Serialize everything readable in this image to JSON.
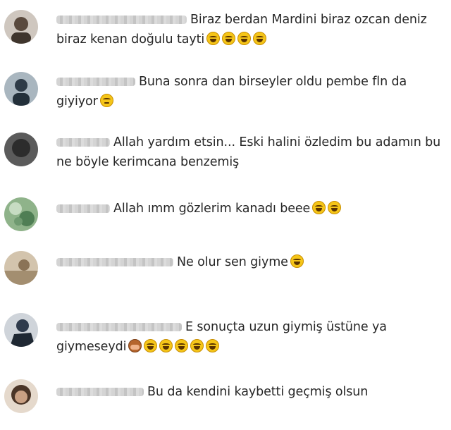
{
  "comments": [
    {
      "avatar_color": "#5a4a3e",
      "text": "Biraz berdan Mardini biraz ozcan deniz biraz kenan doğulu tayti",
      "emojis": [
        "laughing-tears",
        "laughing-tears",
        "laughing-tears",
        "laughing-tears"
      ]
    },
    {
      "avatar_color": "#4a6070",
      "text": "Buna sonra dan birseyler oldu pembe fln da giyiyor",
      "emojis": [
        "thinking-face"
      ]
    },
    {
      "avatar_color": "#3c3c3c",
      "text": "Allah yardım etsin... Eski halini özledim bu adamın bu ne böyle kerimcana benzemiş",
      "emojis": []
    },
    {
      "avatar_color": "#6f9a70",
      "text": "Allah ımm gözlerim kanadı beee",
      "emojis": [
        "laughing-tears",
        "laughing-tears"
      ]
    },
    {
      "avatar_color": "#b9a58a",
      "text": "Ne olur sen giyme",
      "emojis": [
        "laughing-tears"
      ]
    },
    {
      "avatar_color": "#2f3b4c",
      "text": "E sonuçta uzun giymiş üstüne ya giymeseydi",
      "emojis": [
        "see-no-evil-monkey",
        "laughing-tears",
        "laughing-tears",
        "laughing-tears",
        "laughing-tears",
        "laughing-tears"
      ]
    },
    {
      "avatar_color": "#6e5440",
      "text": "Bu da kendini kaybetti geçmiş olsun",
      "emojis": []
    }
  ]
}
